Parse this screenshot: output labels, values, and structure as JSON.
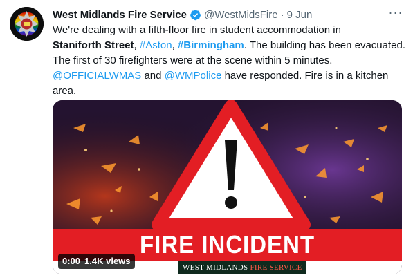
{
  "tweet": {
    "display_name": "West Midlands Fire Service",
    "handle": "@WestMidsFire",
    "separator": "·",
    "date": "9 Jun",
    "more_icon": "more-horizontal-icon",
    "verified_icon": "verified-badge-icon",
    "text": {
      "p1": "We're dealing with a fifth-floor fire in student accommodation in",
      "street": "Staniforth Street",
      "comma1": ", ",
      "tag_aston": "#Aston",
      "comma2": ", ",
      "tag_birmingham": "#Birmingham",
      "p2": ". The building has been evacuated. The first of 30 firefighters were at the scene within 5 minutes.",
      "mention_wmas": "@OFFICIALWMAS",
      "and": " and ",
      "mention_police": "@WMPolice",
      "p3": " have responded. Fire is in a kitchen area."
    }
  },
  "media": {
    "banner_text": "FIRE INCIDENT",
    "brand_part1": "WEST MIDLANDS ",
    "brand_part2": "FIRE SERVICE",
    "video_time": "0:00",
    "video_views": "1.4K views"
  },
  "colors": {
    "link": "#1d9bf0",
    "banner_red": "#e31e24",
    "verified_blue": "#1d9bf0"
  }
}
